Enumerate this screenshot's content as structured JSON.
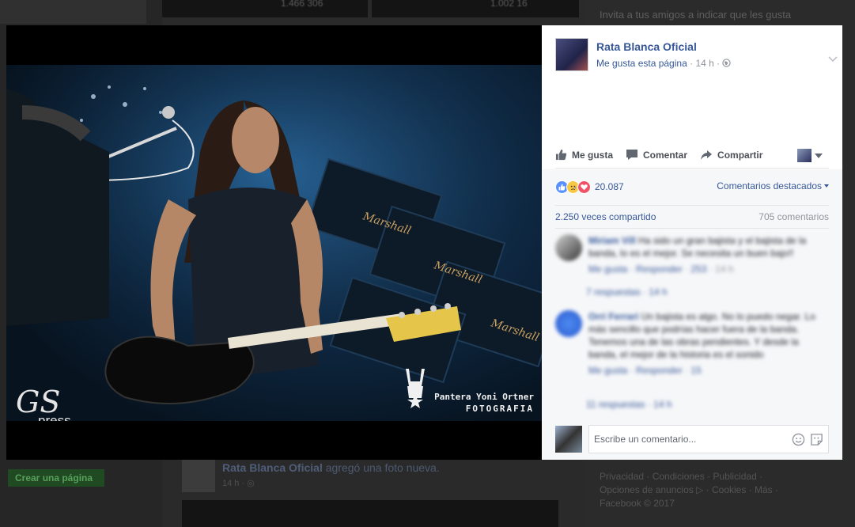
{
  "colors": {
    "brand_link": "#365899",
    "grey_text": "#90949c",
    "like_blue": "#5890ff",
    "love_red": "#f25268",
    "sad_yellow": "#f7c845"
  },
  "background": {
    "invite_text": "Invita a tus amigos a indicar que les gusta",
    "top_stats_1": "1.466   306",
    "top_stats_2": "1.002   16",
    "create_page_button": "Crear una página",
    "post_author": "Rata Blanca Oficial",
    "post_action": "agregó una foto nueva.",
    "post_time": "14 h · ◎",
    "footer_text": "Privacidad · Condiciones · Publicidad · Opciones de anuncios ▷ · Cookies · Más · Facebook © 2017"
  },
  "photo": {
    "watermark_left_script": "GS",
    "watermark_left_sub": "press",
    "watermark_right_line1": "Pantera Yoni Ortner",
    "watermark_right_line2": "FOTOGRAFIA"
  },
  "panel": {
    "page_name": "Rata Blanca Oficial",
    "meta_link": "Me gusta esta página",
    "meta_sep": "·",
    "meta_time": "14 h",
    "meta_sep2": "·",
    "actions": {
      "like": "Me gusta",
      "comment": "Comentar",
      "share": "Compartir"
    },
    "reactions": {
      "count": "20.087",
      "icons": [
        "like-icon",
        "sad-icon",
        "love-icon"
      ]
    },
    "featured_comments": "Comentarios destacados",
    "shares": "2.250 veces compartido",
    "comments_count": "705 comentarios",
    "comments": [
      {
        "author": "Miriam Vill",
        "text": "Ha sido un gran bajista y el bajista de la banda, lo es el mejor. Se necesita un buen bajo!!",
        "links": "Me gusta · Responder",
        "reaction_count": "253",
        "time": "14 h",
        "replies": "7 respuestas · 14 h"
      },
      {
        "author": "Orri Ferrari",
        "text": "Un bajista es algo. No lo puedo negar. Lo más sencillo que podrías hacer fuera de la banda. Tenemos una de las obras pendientes. Y desde la banda, el mejor de la historia es el sonido",
        "links": "Me gusta · Responder",
        "reaction_count": "15",
        "time": "14 h",
        "replies": "11 respuestas · 14 h"
      }
    ],
    "composer_placeholder": "Escribe un comentario..."
  }
}
